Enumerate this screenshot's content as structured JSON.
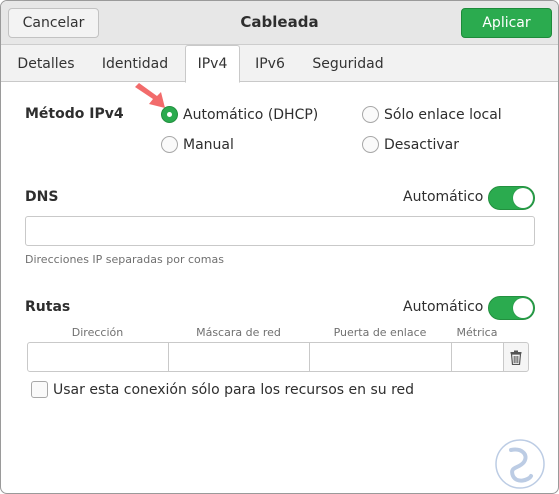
{
  "header": {
    "cancel_label": "Cancelar",
    "title": "Cableada",
    "apply_label": "Aplicar"
  },
  "tabs": [
    {
      "label": "Detalles"
    },
    {
      "label": "Identidad"
    },
    {
      "label": "IPv4"
    },
    {
      "label": "IPv6"
    },
    {
      "label": "Seguridad"
    }
  ],
  "active_tab": "IPv4",
  "method": {
    "label": "Método IPv4",
    "options": [
      {
        "label": "Automático (DHCP)",
        "selected": true
      },
      {
        "label": "Sólo enlace local",
        "selected": false
      },
      {
        "label": "Manual",
        "selected": false
      },
      {
        "label": "Desactivar",
        "selected": false
      }
    ]
  },
  "dns": {
    "label": "DNS",
    "auto_label": "Automático",
    "auto_on": true,
    "value": "",
    "hint": "Direcciones IP separadas por comas"
  },
  "routes": {
    "label": "Rutas",
    "auto_label": "Automático",
    "auto_on": true,
    "columns": [
      "Dirección",
      "Máscara de red",
      "Puerta de enlace",
      "Métrica"
    ]
  },
  "restrict_checkbox": {
    "label": "Usar esta conexión sólo para los recursos en su red",
    "checked": false
  },
  "colors": {
    "accent": "#2bab4f",
    "arrow": "#f26b6b"
  }
}
